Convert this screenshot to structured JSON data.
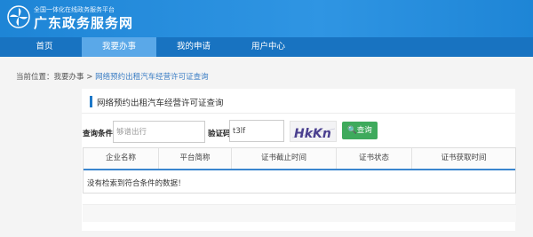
{
  "header": {
    "logo_icon": "windmill-logo-icon",
    "subtitle": "全国一体化在线政务服务平台",
    "title": "广东政务服务网",
    "colors": {
      "banner": "#1e85d6",
      "nav": "#1873c1",
      "nav_active": "#5aa8e8"
    }
  },
  "nav": {
    "items": [
      {
        "label": "首页",
        "active": false
      },
      {
        "label": "我要办事",
        "active": true
      },
      {
        "label": "我的申请",
        "active": false
      },
      {
        "label": "用户中心",
        "active": false
      }
    ]
  },
  "breadcrumb": {
    "prefix": "当前位置：",
    "first": "我要办事",
    "separator": " > ",
    "current": "网络预约出租汽车经营许可证查询"
  },
  "panel": {
    "title": "网络预约出租汽车经营许可证查询"
  },
  "search": {
    "condition_label": "查询条件",
    "condition_placeholder": "够谱出行",
    "captcha_label": "验证码",
    "captcha_value": "t3lf",
    "captcha_image_text": "HkKn",
    "query_button": "查询",
    "query_icon": "search-icon",
    "button_color": "#3eaa5c"
  },
  "table": {
    "columns": [
      "企业名称",
      "平台简称",
      "证书截止时间",
      "证书状态",
      "证书获取时间"
    ],
    "empty_message": "没有检索到符合条件的数据！"
  }
}
